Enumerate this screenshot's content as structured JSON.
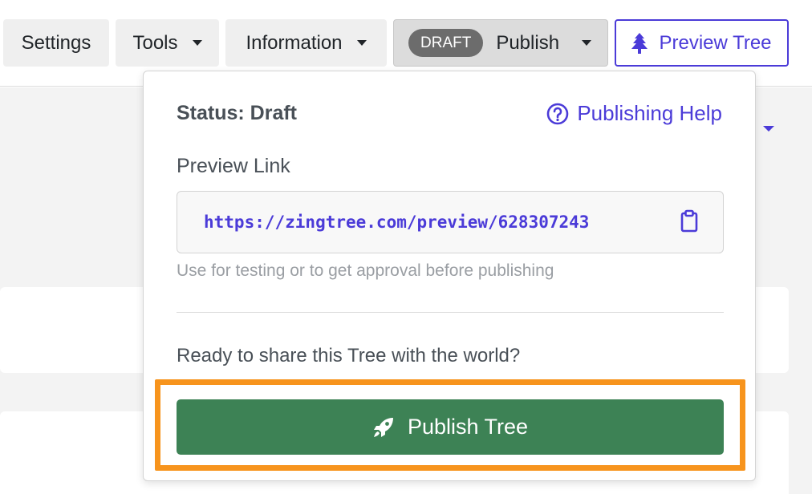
{
  "toolbar": {
    "settings_label": "Settings",
    "tools_label": "Tools",
    "information_label": "Information",
    "publish_badge": "DRAFT",
    "publish_label": "Publish",
    "preview_tree_label": "Preview Tree"
  },
  "publish_menu": {
    "status": "Status: Draft",
    "help_label": "Publishing Help",
    "preview_link_label": "Preview Link",
    "preview_url": "https://zingtree.com/preview/628307243",
    "preview_hint": "Use for testing or to get approval before publishing",
    "ready_prompt": "Ready to share this Tree with the world?",
    "publish_button_label": "Publish Tree"
  },
  "icons": {
    "preview": "tree-icon",
    "help": "question-circle-icon",
    "copy": "clipboard-icon",
    "publish": "rocket-icon"
  },
  "colors": {
    "accent": "#4b3bd8",
    "publish_green": "#3d8255",
    "highlight_orange": "#f7941d",
    "draft_badge": "#6c6c6c"
  }
}
